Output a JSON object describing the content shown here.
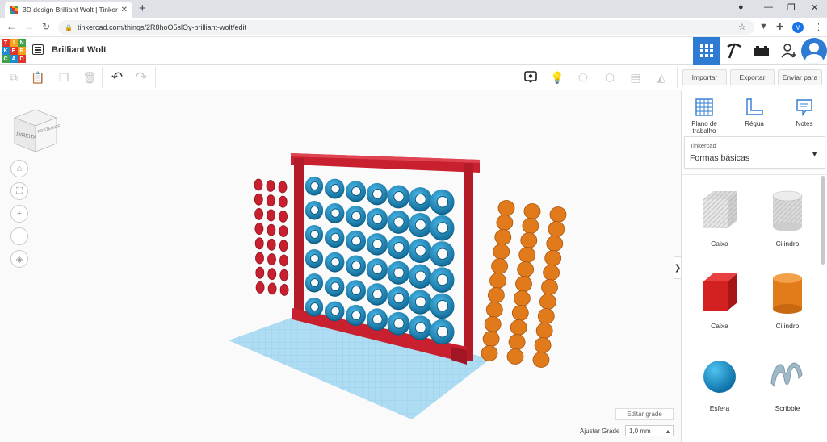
{
  "browser": {
    "tab_title": "3D design Brilliant Wolt | Tinkerc",
    "url": "tinkercad.com/things/2R8hoO5slOy-brilliant-wolt/edit",
    "profile_initial": "M"
  },
  "app": {
    "logo_letters": [
      "T",
      "I",
      "N",
      "K",
      "E",
      "R",
      "C",
      "A",
      "D"
    ],
    "project_name": "Brilliant Wolt"
  },
  "toolbar": {
    "import_label": "Importar",
    "export_label": "Exportar",
    "send_label": "Enviar para"
  },
  "viewcube": {
    "face_left": "DIREITA",
    "face_right": "POSTERIOR"
  },
  "panel": {
    "tools": [
      {
        "label": "Plano de\ntrabalho"
      },
      {
        "label": "Régua"
      },
      {
        "label": "Notes"
      }
    ],
    "library_source": "Tinkercad",
    "library_name": "Formas básicas",
    "shapes": [
      {
        "label": "Caixa"
      },
      {
        "label": "Cilindro"
      },
      {
        "label": "Caixa"
      },
      {
        "label": "Cilindro"
      },
      {
        "label": "Esfera"
      },
      {
        "label": "Scribble"
      }
    ]
  },
  "workspace": {
    "edit_grid_label": "Editar grade",
    "snap_label": "Ajustar Grade",
    "snap_value": "1,0 mm"
  },
  "colors": {
    "accent_blue": "#2d7bd2",
    "frame_red": "#c8202f",
    "ring_blue": "#1e8bbf",
    "disc_orange": "#e07a1b",
    "plate_blue": "#a9dbf1"
  }
}
